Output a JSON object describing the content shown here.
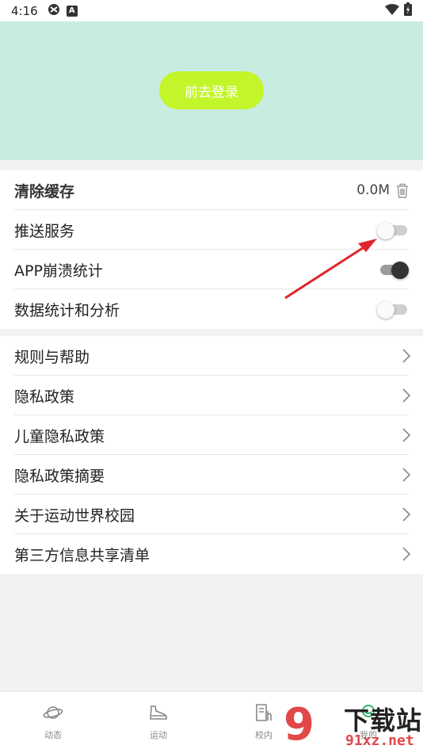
{
  "status_bar": {
    "time": "4:16",
    "notif_icon_letter": "A"
  },
  "hero": {
    "login_button": "前去登录",
    "background": "#c8ede0",
    "button_color": "#c3f52b"
  },
  "settings": {
    "clear_cache": {
      "label": "清除缓存",
      "value": "0.0M"
    },
    "push_service": {
      "label": "推送服务",
      "enabled": false
    },
    "crash_stats": {
      "label": "APP崩溃统计",
      "enabled": true
    },
    "data_analysis": {
      "label": "数据统计和分析",
      "enabled": false
    }
  },
  "links": [
    {
      "label": "规则与帮助"
    },
    {
      "label": "隐私政策"
    },
    {
      "label": "儿童隐私政策"
    },
    {
      "label": "隐私政策摘要"
    },
    {
      "label": "关于运动世界校园"
    },
    {
      "label": "第三方信息共享清单"
    }
  ],
  "tabs": [
    {
      "label": "动态"
    },
    {
      "label": "运动"
    },
    {
      "label": "校内"
    },
    {
      "label": "我的"
    }
  ],
  "watermark": {
    "logo": "9",
    "text_main": "下载站",
    "text_sub": "91xz.net"
  },
  "annotation": {
    "arrow_color": "#e0262b"
  }
}
